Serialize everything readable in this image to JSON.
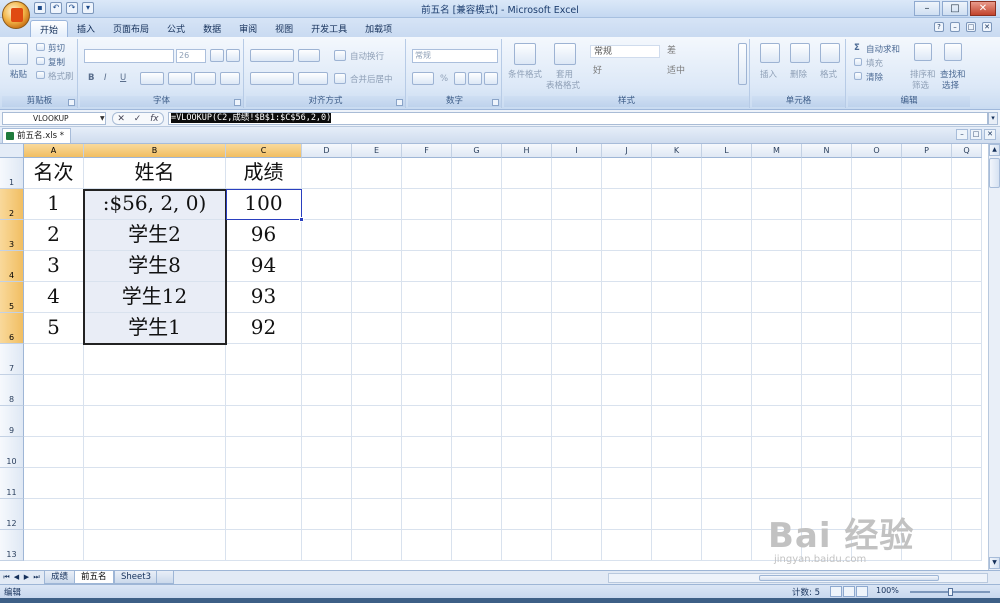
{
  "window": {
    "title": "前五名  [兼容模式] - Microsoft Excel"
  },
  "ribbon": {
    "tabs": [
      "开始",
      "插入",
      "页面布局",
      "公式",
      "数据",
      "审阅",
      "视图",
      "开发工具",
      "加载项"
    ],
    "active_tab": "开始",
    "clipboard": {
      "paste": "粘贴",
      "cut": "剪切",
      "copy": "复制",
      "format_painter": "格式刷",
      "label": "剪贴板"
    },
    "font": {
      "size": "26",
      "bold": "B",
      "italic": "I",
      "underline": "U",
      "label": "字体"
    },
    "alignment": {
      "wrap": "自动换行",
      "merge": "合并后居中",
      "label": "对齐方式"
    },
    "number": {
      "format": "常规",
      "percent": "%",
      "label": "数字"
    },
    "styles": {
      "conditional": "条件格式",
      "table": "套用",
      "table2": "表格格式",
      "normal": "常规",
      "bad": "差",
      "good": "好",
      "neutral": "适中",
      "label": "样式"
    },
    "cells": {
      "insert": "插入",
      "delete": "删除",
      "format": "格式",
      "label": "单元格"
    },
    "editing": {
      "autosum": "自动求和",
      "fill": "填充",
      "clear": "清除",
      "sort": "排序和",
      "sort2": "筛选",
      "find": "查找和",
      "find2": "选择",
      "label": "编辑"
    }
  },
  "formula_bar": {
    "name_box": "VLOOKUP",
    "formula": "=VLOOKUP(C2,成绩!$B$1:$C$56,2,0)"
  },
  "workbook_tab": "前五名.xls *",
  "columns": [
    "A",
    "B",
    "C",
    "D",
    "E",
    "F",
    "G",
    "H",
    "I",
    "J",
    "K",
    "L",
    "M",
    "N",
    "O",
    "P",
    "Q"
  ],
  "rows": [
    "1",
    "2",
    "3",
    "4",
    "5",
    "6",
    "7",
    "8",
    "9",
    "10",
    "11",
    "12",
    "13"
  ],
  "cells": [
    [
      "名次",
      "姓名",
      "成绩"
    ],
    [
      "1",
      ":$56, 2, 0)",
      "100"
    ],
    [
      "2",
      "学生2",
      "96"
    ],
    [
      "3",
      "学生8",
      "94"
    ],
    [
      "4",
      "学生12",
      "93"
    ],
    [
      "5",
      "学生1",
      "92"
    ]
  ],
  "sheet_tabs": [
    "成绩",
    "前五名",
    "Sheet3"
  ],
  "active_sheet": "前五名",
  "status": {
    "mode": "编辑",
    "count": "计数: 5",
    "zoom": "100%"
  },
  "watermark": {
    "text": "Bai 经验",
    "sub": "jingyan.baidu.com"
  },
  "colors": {
    "selection_header": "#f1be62",
    "range_shade": "#e9edf6",
    "active_border": "#2a3fbf"
  }
}
